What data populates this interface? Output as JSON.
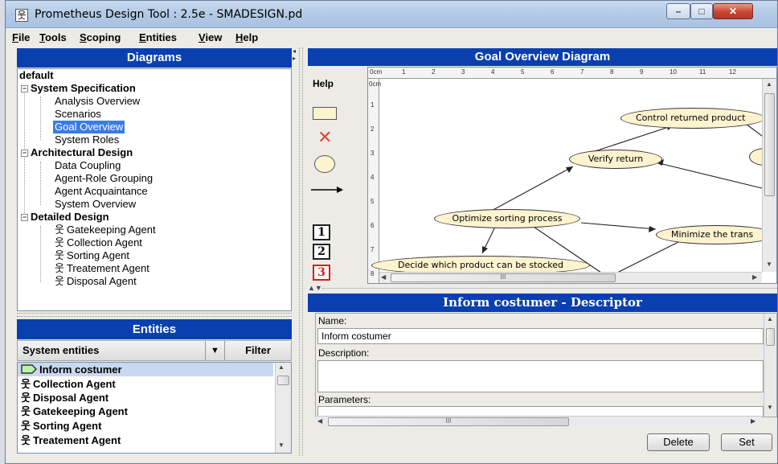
{
  "window": {
    "title": "Prometheus Design Tool : 2.5e - SMADESIGN.pd",
    "app_icon": "agent-icon"
  },
  "menu": [
    {
      "u": "F",
      "rest": "ile"
    },
    {
      "u": "T",
      "rest": "ools"
    },
    {
      "u": "S",
      "rest": "coping"
    },
    {
      "u": "E",
      "rest": "ntities"
    },
    {
      "u": "V",
      "rest": "iew"
    },
    {
      "u": "H",
      "rest": "elp"
    }
  ],
  "diagrams": {
    "header": "Diagrams",
    "root": "default",
    "sections": [
      {
        "label": "System Specification",
        "items": [
          "Analysis Overview",
          "Scenarios",
          "Goal Overview",
          "System Roles"
        ]
      },
      {
        "label": "Architectural Design",
        "items": [
          "Data Coupling",
          "Agent-Role Grouping",
          "Agent Acquaintance",
          "System Overview"
        ]
      },
      {
        "label": "Detailed Design",
        "items": [
          "Gatekeeping Agent",
          "Collection Agent",
          "Sorting Agent",
          "Treatement Agent",
          "Disposal Agent"
        ]
      }
    ],
    "selected": "Goal Overview"
  },
  "entities": {
    "header": "Entities",
    "select_value": "System entities",
    "filter_label": "Filter",
    "items": [
      {
        "label": "Inform costumer",
        "icon": "goal-tag-icon",
        "selected": true
      },
      {
        "label": "Collection Agent",
        "icon": "agent-icon"
      },
      {
        "label": "Disposal Agent",
        "icon": "agent-icon"
      },
      {
        "label": "Gatekeeping Agent",
        "icon": "agent-icon"
      },
      {
        "label": "Sorting Agent",
        "icon": "agent-icon"
      },
      {
        "label": "Treatement Agent",
        "icon": "agent-icon"
      }
    ]
  },
  "diagram_panel": {
    "header": "Goal Overview Diagram",
    "toolbar": {
      "help_label": "Help",
      "num_buttons": [
        "1",
        "2",
        "3"
      ]
    },
    "ruler_top_unit": "0cm",
    "ruler_top_ticks": [
      "1",
      "2",
      "3",
      "4",
      "5",
      "6",
      "7",
      "8",
      "9",
      "10",
      "11",
      "12"
    ],
    "ruler_left_unit": "0cm",
    "ruler_left_ticks": [
      "1",
      "2",
      "3",
      "4",
      "5",
      "6",
      "7",
      "8"
    ],
    "goals": {
      "control": "Control returned product",
      "verify": "Verify return",
      "optimize": "Optimize sorting process",
      "minimize": "Minimize the trans",
      "decide": "Decide which product can be stocked"
    }
  },
  "descriptor": {
    "header": "Inform costumer - Descriptor",
    "name_label": "Name:",
    "name_value": "Inform costumer",
    "description_label": "Description:",
    "description_value": "",
    "parameters_label": "Parameters:",
    "delete_label": "Delete",
    "set_label": "Set"
  },
  "colors": {
    "header_blue": "#0a3fb0",
    "selection": "#3a7ce6",
    "goal_fill": "#fdf3cf",
    "toolbar_delete_red": "#d94b3a"
  }
}
